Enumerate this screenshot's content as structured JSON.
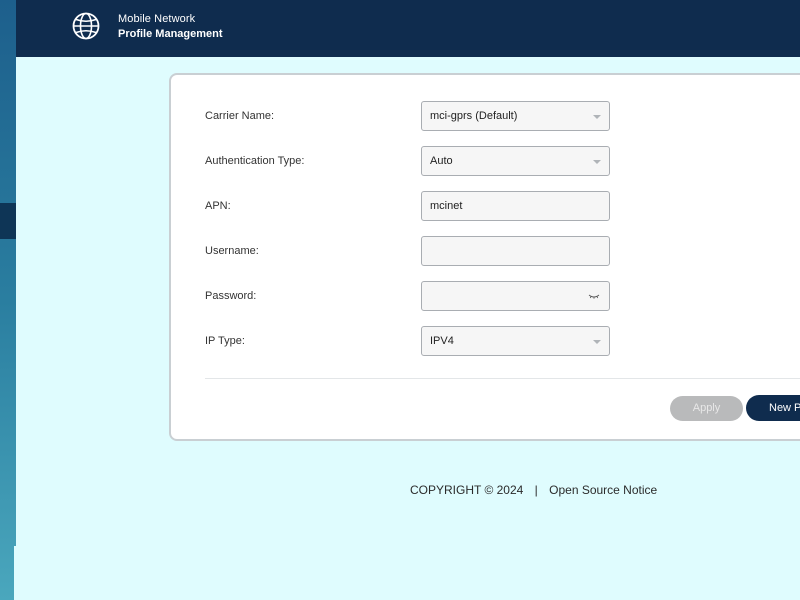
{
  "header": {
    "line1": "Mobile Network",
    "line2": "Profile Management",
    "icon": "globe-icon"
  },
  "form": {
    "carrier_label": "Carrier Name:",
    "carrier_value": "mci-gprs (Default)",
    "auth_label": "Authentication Type:",
    "auth_value": "Auto",
    "apn_label": "APN:",
    "apn_value": "mcinet",
    "username_label": "Username:",
    "username_value": "",
    "password_label": "Password:",
    "password_value": "",
    "iptype_label": "IP Type:",
    "iptype_value": "IPV4"
  },
  "buttons": {
    "apply": "Apply",
    "new": "New P"
  },
  "footer": {
    "copyright": "COPYRIGHT © 2024",
    "separator": "|",
    "open_source": "Open Source Notice"
  },
  "colors": {
    "header_bg": "#0f2c4e",
    "page_bg": "#dffcfe",
    "primary_button": "#0f2c4e",
    "disabled_button": "#b9babb"
  }
}
